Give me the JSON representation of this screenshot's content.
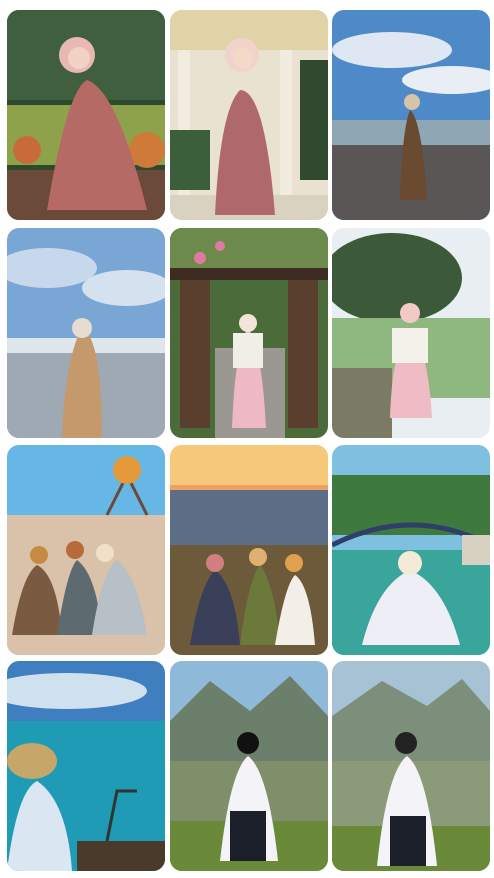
{
  "gallery": {
    "columns": 3,
    "rows": 4,
    "background": "#ffffff",
    "tiles": [
      {
        "scene": "garden-bench",
        "sky": "#3a5a3a",
        "ground": "#8da24a",
        "outfit": "#b56a66",
        "hijab": "#e8b9b3"
      },
      {
        "scene": "gazebo",
        "sky": "#f0e6c8",
        "ground": "#d9d2c0",
        "outfit": "#b0696a",
        "hijab": "#f1d3cb"
      },
      {
        "scene": "beach-cloudy",
        "sky": "#4f8ac8",
        "ground": "#5b5656",
        "outfit": "#6a4a30",
        "hijab": "#d7c3a7"
      },
      {
        "scene": "beach-calm",
        "sky": "#7aa6d6",
        "ground": "#9fa9b3",
        "outfit": "#c49a6c",
        "hijab": "#e6dccf"
      },
      {
        "scene": "pergola-garden",
        "sky": "#4b6b3a",
        "ground": "#9a9890",
        "outfit": "#eeb9c4",
        "hijab": "#f3e5da"
      },
      {
        "scene": "lakeside",
        "sky": "#e8eef2",
        "ground": "#7b7a64",
        "outfit": "#efbcc6",
        "hijab": "#f2c9c7"
      },
      {
        "scene": "sand-dunes",
        "sky": "#66b6e6",
        "ground": "#d9c1aa",
        "outfit": "#7a5a40",
        "hijab": "#c58b45"
      },
      {
        "scene": "sunset-hill",
        "sky": "#f0a060",
        "ground": "#6c5a3a",
        "outfit": "#3a3f5a",
        "hijab": "#d08080"
      },
      {
        "scene": "bridge-lake",
        "sky": "#7fc0e0",
        "ground": "#3aa59a",
        "outfit": "#eeeef6",
        "hijab": "#f4ead8"
      },
      {
        "scene": "sea-deck",
        "sky": "#3f7fc0",
        "ground": "#1f9bb5",
        "outfit": "#dbe6f3",
        "hijab": "#c7a66a"
      },
      {
        "scene": "mountain-village",
        "sky": "#8fb9d8",
        "ground": "#7f8f6a",
        "outfit": "#f3f3f8",
        "hijab": "#111111"
      },
      {
        "scene": "mountain-village-2",
        "sky": "#a7c2d4",
        "ground": "#8b9a78",
        "outfit": "#f3f3f8",
        "hijab": "#222222"
      }
    ]
  }
}
